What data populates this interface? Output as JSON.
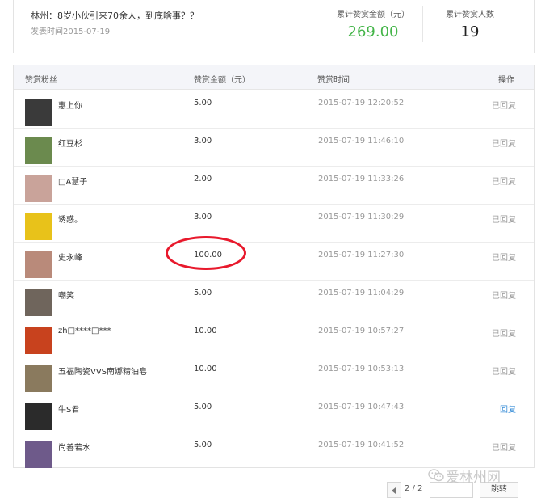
{
  "article": {
    "title": "林州：8岁小伙引来70余人，到底啥事？？",
    "publish_date": "发表时间2015-07-19"
  },
  "stats": {
    "total_amount_label": "累计赞赏金额（元）",
    "total_amount": "269.00",
    "total_people_label": "累计赞赏人数",
    "total_people": "19"
  },
  "table": {
    "headers": {
      "fan": "赞赏粉丝",
      "amount": "赞赏金额（元）",
      "time": "赞赏时间",
      "action": "操作"
    },
    "rows": [
      {
        "nick": "惠上你",
        "amount": "5.00",
        "time": "2015-07-19 12:20:52",
        "action": "已回复",
        "avatar_color": "#3a3a3a"
      },
      {
        "nick": "红豆杉",
        "amount": "3.00",
        "time": "2015-07-19 11:46:10",
        "action": "已回复",
        "avatar_color": "#6b8a4e"
      },
      {
        "nick": "□A慧子",
        "amount": "2.00",
        "time": "2015-07-19 11:33:26",
        "action": "已回复",
        "avatar_color": "#c9a39a"
      },
      {
        "nick": "诱惑。",
        "amount": "3.00",
        "time": "2015-07-19 11:30:29",
        "action": "已回复",
        "avatar_color": "#e8c21a"
      },
      {
        "nick": "史永峰",
        "amount": "100.00",
        "time": "2015-07-19 11:27:30",
        "action": "已回复",
        "avatar_color": "#b98a7a"
      },
      {
        "nick": "嘲笑",
        "amount": "5.00",
        "time": "2015-07-19 11:04:29",
        "action": "已回复",
        "avatar_color": "#6f655c"
      },
      {
        "nick": "zh□****□***",
        "amount": "10.00",
        "time": "2015-07-19 10:57:27",
        "action": "已回复",
        "avatar_color": "#c8421e"
      },
      {
        "nick": "五福陶瓷VVS南娜精油皂",
        "amount": "10.00",
        "time": "2015-07-19 10:53:13",
        "action": "已回复",
        "avatar_color": "#8a7a5e"
      },
      {
        "nick": "牛S君",
        "amount": "5.00",
        "time": "2015-07-19 10:47:43",
        "action": "回复",
        "avatar_color": "#2b2b2b"
      },
      {
        "nick": "尚善若水",
        "amount": "5.00",
        "time": "2015-07-19 10:41:52",
        "action": "已回复",
        "avatar_color": "#6e5a8a"
      }
    ]
  },
  "pagination": {
    "page_indicator": "2 / 2",
    "go_label": "跳转"
  },
  "watermark": {
    "text": "爱林州网",
    "icon": "wechat-icon"
  }
}
